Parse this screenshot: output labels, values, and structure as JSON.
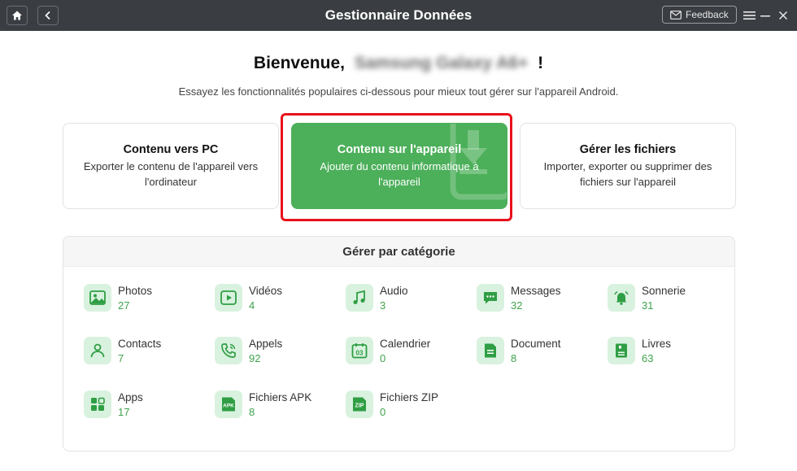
{
  "titlebar": {
    "title": "Gestionnaire Données",
    "feedback_label": "Feedback",
    "icons": [
      "home-icon",
      "back-icon",
      "mail-icon",
      "menu-icon",
      "minimize-icon",
      "close-icon"
    ]
  },
  "welcome": {
    "greeting": "Bienvenue,",
    "device_name": "Samsung Galaxy A6+",
    "exclamation": "!",
    "subtitle": "Essayez les fonctionnalités populaires ci-dessous pour mieux tout gérer sur l'appareil Android."
  },
  "cards": [
    {
      "title": "Contenu vers PC",
      "desc": "Exporter le contenu de l'appareil vers l'ordinateur"
    },
    {
      "title": "Contenu sur l'appareil",
      "desc": "Ajouter du contenu informatique à l'appareil"
    },
    {
      "title": "Gérer les fichiers",
      "desc": "Importer, exporter ou supprimer des fichiers sur l'appareil"
    }
  ],
  "categories": {
    "title": "Gérer par catégorie",
    "items": [
      {
        "name": "Photos",
        "count": "27",
        "icon": "photo-icon"
      },
      {
        "name": "Vidéos",
        "count": "4",
        "icon": "video-icon"
      },
      {
        "name": "Audio",
        "count": "3",
        "icon": "music-icon"
      },
      {
        "name": "Messages",
        "count": "32",
        "icon": "message-icon"
      },
      {
        "name": "Sonnerie",
        "count": "31",
        "icon": "bell-icon"
      },
      {
        "name": "Contacts",
        "count": "7",
        "icon": "contact-icon"
      },
      {
        "name": "Appels",
        "count": "92",
        "icon": "phone-icon"
      },
      {
        "name": "Calendrier",
        "count": "0",
        "icon": "calendar-icon"
      },
      {
        "name": "Document",
        "count": "8",
        "icon": "document-icon"
      },
      {
        "name": "Livres",
        "count": "63",
        "icon": "book-icon"
      },
      {
        "name": "Apps",
        "count": "17",
        "icon": "apps-icon"
      },
      {
        "name": "Fichiers APK",
        "count": "8",
        "icon": "apk-icon"
      },
      {
        "name": "Fichiers ZIP",
        "count": "0",
        "icon": "zip-icon"
      }
    ],
    "calendar_day": "03",
    "apk_label": "APK",
    "zip_label": "ZIP"
  },
  "colors": {
    "titlebar": "#3a3d42",
    "accent_green": "#4caf5a",
    "count_green": "#3fa34d",
    "icon_bg": "#d9f2df",
    "highlight_red": "#e8111b"
  }
}
